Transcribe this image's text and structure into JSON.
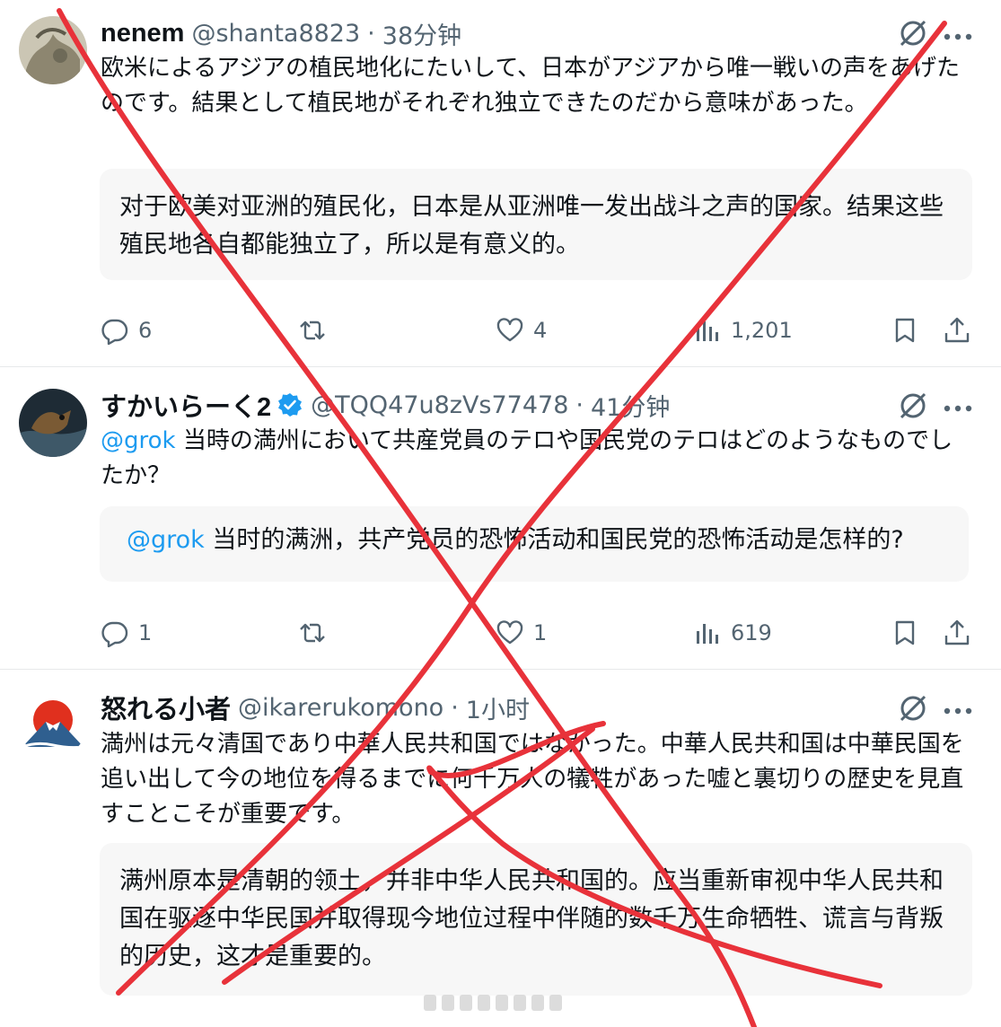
{
  "tweets": [
    {
      "name": "nenem",
      "handle": "@shanta8823",
      "time": "38分钟",
      "text": "欧米によるアジアの植民地化にたいして、日本がアジアから唯一戦いの声をあげたのです。結果として植民地がそれぞれ独立できたのだから意味があった。",
      "translation": "对于欧美对亚洲的殖民化，日本是从亚洲唯一发出战斗之声的国家。结果这些殖民地各自都能独立了，所以是有意义的。",
      "replies": "6",
      "retweets": "",
      "likes": "4",
      "views": "1,201"
    },
    {
      "name": "すかいらーく2",
      "handle": "@TQQ47u8zVs77478",
      "time": "41分钟",
      "mention": "@grok",
      "text": " 当時の満州において共産党員のテロや国民党のテロはどのようなものでしたか？",
      "translation_mention": "@grok",
      "translation": " 当时的满洲，共产党员的恐怖活动和国民党的恐怖活动是怎样的?",
      "replies": "1",
      "retweets": "",
      "likes": "1",
      "views": "619"
    },
    {
      "name": "怒れる小者",
      "handle": "@ikarerukomono",
      "time": "1小时",
      "text": "満州は元々清国であり中華人民共和国ではなかった。中華人民共和国は中華民国を追い出して今の地位を得るまでに何千万人の犠牲があった嘘と裏切りの歴史を見直すことこそが重要です。",
      "translation": "满州原本是清朝的领土，并非中华人民共和国的。应当重新审视中华人民共和国在驱逐中华民国并取得现今地位过程中伴随的数千万生命牺牲、谎言与背叛的历史，这才是重要的。"
    }
  ],
  "colors": {
    "text": "#0f1419",
    "muted": "#536471",
    "accent": "#1d9bf0",
    "strike": "#e8323a"
  },
  "icons": [
    "reply-icon",
    "retweet-icon",
    "like-icon",
    "views-icon",
    "bookmark-icon",
    "share-icon",
    "grok-icon",
    "more-icon",
    "verified-icon"
  ]
}
